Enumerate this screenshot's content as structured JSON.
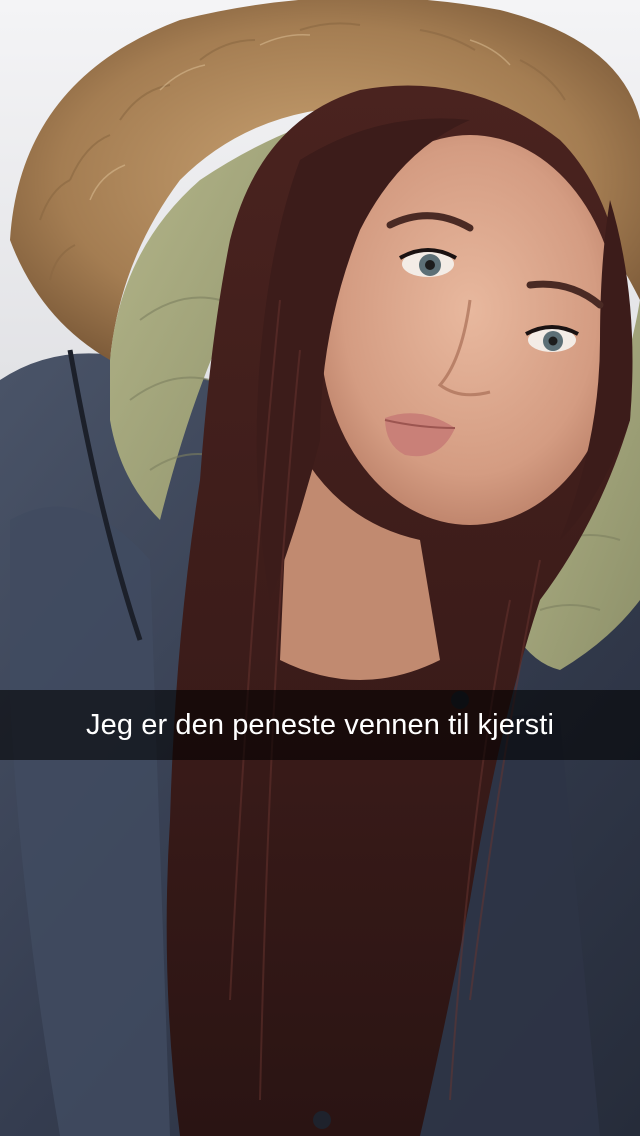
{
  "snap": {
    "caption": "Jeg er den peneste vennen til kjersti"
  },
  "colors": {
    "caption_bar": "#000000",
    "caption_text": "#ffffff",
    "fur": "#b08a5e",
    "hood_lining": "#a5a878",
    "jacket": "#3c4559",
    "hair": "#3a1e1c",
    "skin": "#d9a58c",
    "background": "#e9e9ec"
  }
}
